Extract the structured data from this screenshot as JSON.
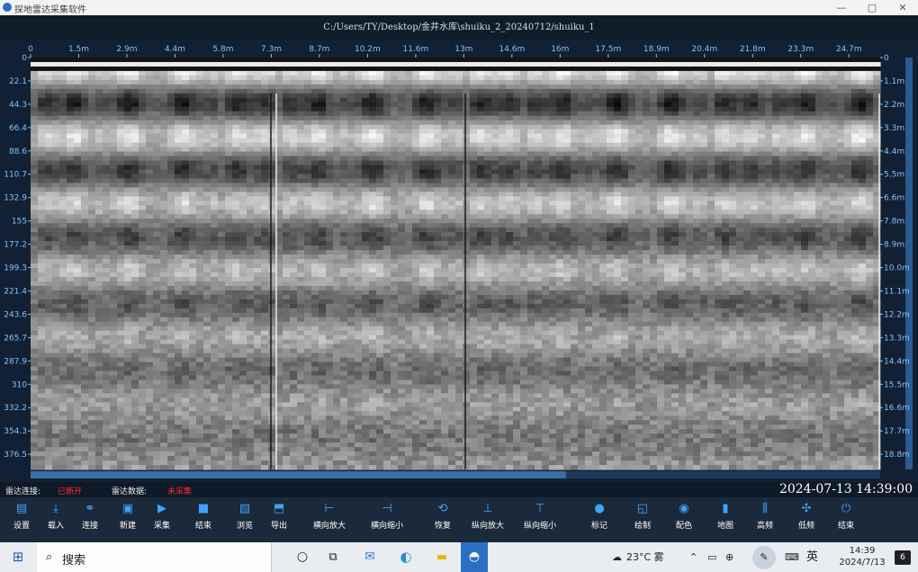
{
  "window": {
    "title": "探地雷达采集软件",
    "minimize_icon": "minimize-icon",
    "maximize_icon": "maximize-icon",
    "close_icon": "close-icon",
    "min_glyph": "—",
    "max_glyph": "▢",
    "close_glyph": "✕"
  },
  "file_path": "C:/Users/TY/Desktop/金井水库\\shuiku_2_20240712/shuiku_1",
  "chart_data": {
    "type": "heatmap",
    "title": "",
    "colormap": "grayscale",
    "top_axis": {
      "labels": [
        "0",
        "1.5m",
        "2.9m",
        "4.4m",
        "5.8m",
        "7.3m",
        "8.7m",
        "10.2m",
        "11.6m",
        "13m",
        "14.6m",
        "16m",
        "17.5m",
        "18.9m",
        "20.4m",
        "21.8m",
        "23.3m",
        "24.7m"
      ]
    },
    "left_axis": {
      "labels": [
        "0",
        "22.1",
        "44.3",
        "66.4",
        "88.6",
        "110.7",
        "132.9",
        "155",
        "177.2",
        "199.3",
        "221.4",
        "243.6",
        "265.7",
        "287.9",
        "310",
        "332.2",
        "354.3",
        "376.5"
      ]
    },
    "right_axis": {
      "labels": [
        "0",
        "1.1m",
        "2.2m",
        "3.3m",
        "4.4m",
        "5.5m",
        "6.6m",
        "7.8m",
        "8.9m",
        "10.0m",
        "11.1m",
        "12.2m",
        "13.3m",
        "14.4m",
        "15.5m",
        "16.6m",
        "17.7m",
        "18.8m"
      ]
    }
  },
  "status": {
    "radar_connect_label": "雷达连接:",
    "radar_connect_value": "已断开",
    "radar_data_label": "雷达数据:",
    "radar_data_value": "未采集",
    "datetime": "2024-07-13 14:39:00"
  },
  "toolbar": [
    {
      "label": "设置",
      "icon": "settings-icon",
      "glyph": "▤"
    },
    {
      "label": "载入",
      "icon": "download-icon",
      "glyph": "⤓"
    },
    {
      "label": "连接",
      "icon": "link-icon",
      "glyph": "⚭"
    },
    {
      "label": "新建",
      "icon": "new-file-icon",
      "glyph": "▣"
    },
    {
      "label": "采集",
      "icon": "play-icon",
      "glyph": "▶"
    },
    {
      "label": "结束",
      "icon": "stop-icon",
      "glyph": "■"
    },
    {
      "label": "浏览",
      "icon": "browse-icon",
      "glyph": "▧"
    },
    {
      "label": "导出",
      "icon": "export-icon",
      "glyph": "⬒"
    },
    {
      "label": "横向放大",
      "icon": "zoom-in-horizontal-icon",
      "glyph": "⊢"
    },
    {
      "label": "横向缩小",
      "icon": "zoom-out-horizontal-icon",
      "glyph": "⊣"
    },
    {
      "label": "恢复",
      "icon": "restore-icon",
      "glyph": "⟲"
    },
    {
      "label": "纵向放大",
      "icon": "zoom-in-vertical-icon",
      "glyph": "⊥"
    },
    {
      "label": "纵向缩小",
      "icon": "zoom-out-vertical-icon",
      "glyph": "⊤"
    },
    {
      "label": "标记",
      "icon": "mark-icon",
      "glyph": "●"
    },
    {
      "label": "绘制",
      "icon": "draw-icon",
      "glyph": "◱"
    },
    {
      "label": "配色",
      "icon": "palette-icon",
      "glyph": "◉"
    },
    {
      "label": "地图",
      "icon": "map-icon",
      "glyph": "▮"
    },
    {
      "label": "高频",
      "icon": "high-frequency-icon",
      "glyph": "⫼"
    },
    {
      "label": "低频",
      "icon": "low-frequency-icon",
      "glyph": "✣"
    },
    {
      "label": "结束",
      "icon": "power-icon",
      "glyph": "⏻"
    }
  ],
  "taskbar": {
    "search_placeholder": "搜索",
    "weather": "23°C 雾",
    "ime": "英",
    "time": "14:39",
    "date": "2024/7/13",
    "notifications": "6"
  },
  "colors": {
    "accent": "#3fa4ff",
    "status_red": "#ff2a2a",
    "axis_text": "#7fc4ff"
  }
}
